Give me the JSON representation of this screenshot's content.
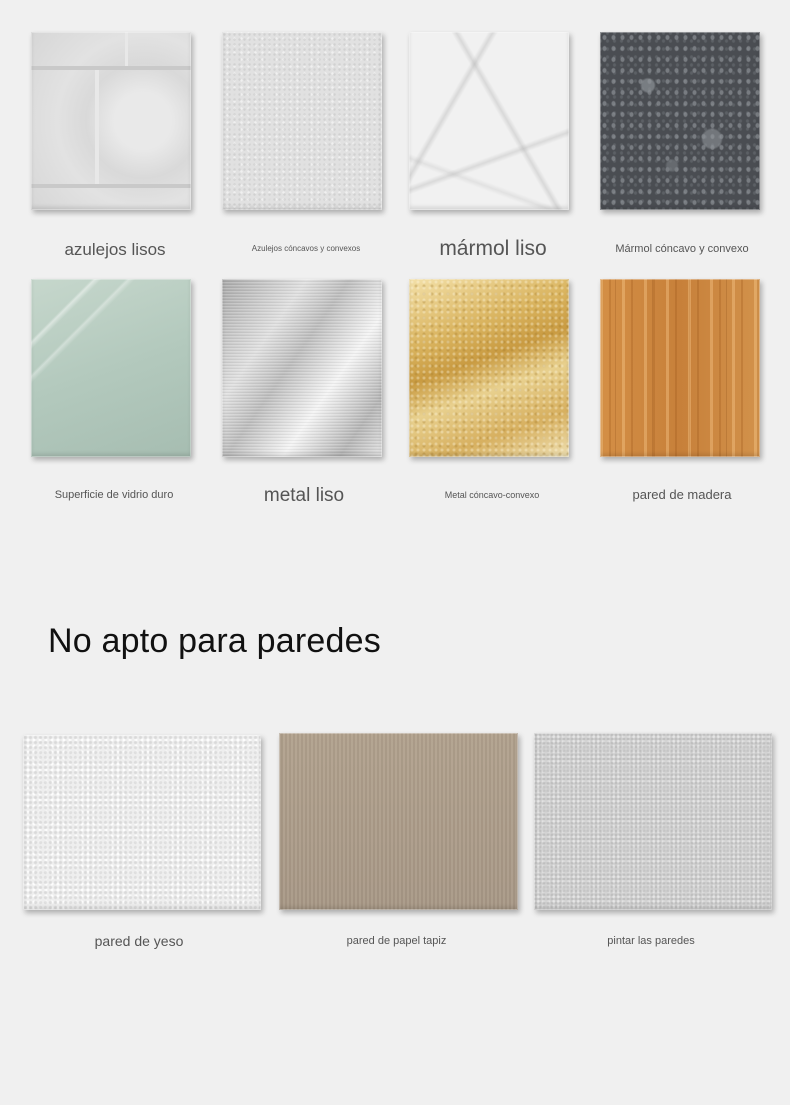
{
  "suitable": {
    "items": [
      {
        "label": "azulejos lisos"
      },
      {
        "label": "Azulejos cóncavos y convexos"
      },
      {
        "label": "mármol liso"
      },
      {
        "label": "Mármol cóncavo y convexo"
      },
      {
        "label": "Superficie de vidrio duro"
      },
      {
        "label": "metal liso"
      },
      {
        "label": "Metal cóncavo-convexo"
      },
      {
        "label": "pared de madera"
      }
    ]
  },
  "unsuitable": {
    "title": "No apto para paredes",
    "items": [
      {
        "label": "pared de yeso"
      },
      {
        "label": "pared de papel tapiz"
      },
      {
        "label": "pintar las paredes"
      }
    ]
  }
}
